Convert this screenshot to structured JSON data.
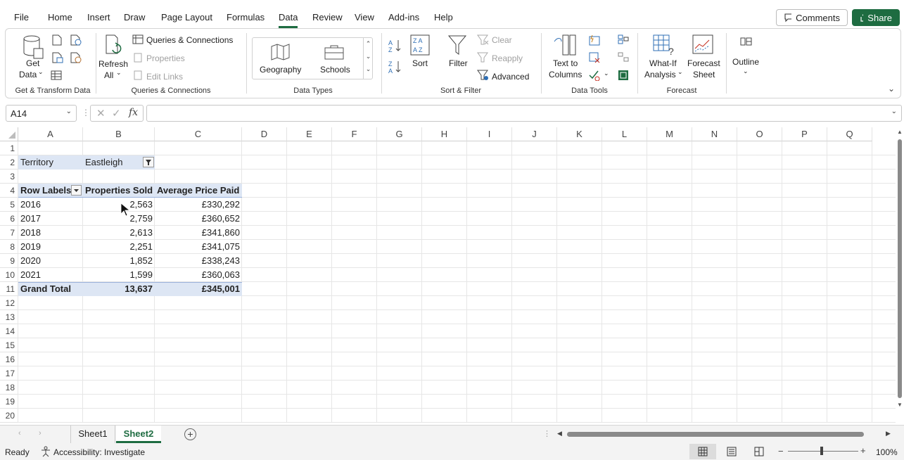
{
  "menu": {
    "tabs": [
      "File",
      "Home",
      "Insert",
      "Draw",
      "Page Layout",
      "Formulas",
      "Data",
      "Review",
      "View",
      "Add-ins",
      "Help"
    ],
    "active": "Data",
    "comments_label": "Comments",
    "share_label": "Share"
  },
  "ribbon": {
    "get_transform": {
      "get_data": "Get",
      "get_data2": "Data",
      "label": "Get & Transform Data"
    },
    "queries": {
      "refresh": "Refresh",
      "refresh2": "All",
      "queries_connections": "Queries & Connections",
      "properties": "Properties",
      "edit_links": "Edit Links",
      "label": "Queries & Connections"
    },
    "data_types": {
      "geography": "Geography",
      "schools": "Schools",
      "label": "Data Types"
    },
    "sort_filter": {
      "sort": "Sort",
      "filter": "Filter",
      "clear": "Clear",
      "reapply": "Reapply",
      "advanced": "Advanced",
      "label": "Sort & Filter"
    },
    "data_tools": {
      "text_to": "Text to",
      "columns": "Columns",
      "label": "Data Tools"
    },
    "forecast": {
      "what_if": "What-If",
      "analysis": "Analysis",
      "forecast": "Forecast",
      "sheet": "Sheet",
      "label": "Forecast"
    },
    "outline": {
      "label": "Outline"
    }
  },
  "formula_bar": {
    "name_box": "A14",
    "formula": ""
  },
  "columns": [
    "A",
    "B",
    "C",
    "D",
    "E",
    "F",
    "G",
    "H",
    "I",
    "J",
    "K",
    "L",
    "M",
    "N",
    "O",
    "P",
    "Q"
  ],
  "rows": [
    "1",
    "2",
    "3",
    "4",
    "5",
    "6",
    "7",
    "8",
    "9",
    "10",
    "11",
    "12",
    "13",
    "14",
    "15",
    "16",
    "17",
    "18",
    "19",
    "20"
  ],
  "pivot": {
    "filter_label": "Territory",
    "filter_value": "Eastleigh",
    "headers": [
      "Row Labels",
      "Properties Sold",
      "Average Price Paid"
    ],
    "data": [
      [
        "2016",
        "2,563",
        "£330,292"
      ],
      [
        "2017",
        "2,759",
        "£360,652"
      ],
      [
        "2018",
        "2,613",
        "£341,860"
      ],
      [
        "2019",
        "2,251",
        "£341,075"
      ],
      [
        "2020",
        "1,852",
        "£338,243"
      ],
      [
        "2021",
        "1,599",
        "£360,063"
      ]
    ],
    "total": [
      "Grand Total",
      "13,637",
      "£345,001"
    ]
  },
  "sheets": [
    "Sheet1",
    "Sheet2"
  ],
  "active_sheet": "Sheet2",
  "status": {
    "ready": "Ready",
    "accessibility": "Accessibility: Investigate",
    "zoom": "100%"
  }
}
